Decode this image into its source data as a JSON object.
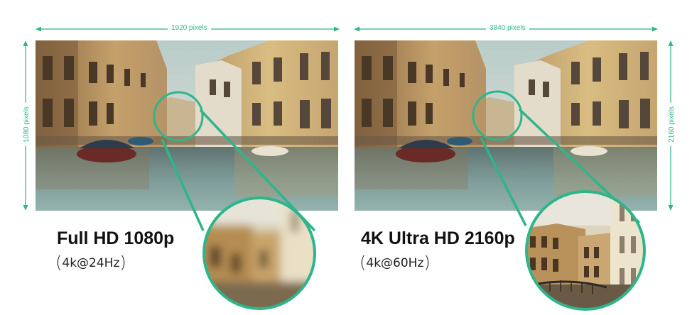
{
  "colors": {
    "accent": "#2fb58a",
    "sky": "#c9d6d3",
    "water": "#6f8f90",
    "building_warm": "#c9a469",
    "building_dark": "#6b5238",
    "text": "#111111"
  },
  "left": {
    "width_label": "1920 pixels",
    "height_label": "1080 pixels",
    "title": "Full HD 1080p",
    "subtitle": "4k@24Hz"
  },
  "right": {
    "width_label": "3840 pixels",
    "height_label": "2160 pixels",
    "title": "4K Ultra HD 2160p",
    "subtitle": "4k@60Hz"
  }
}
